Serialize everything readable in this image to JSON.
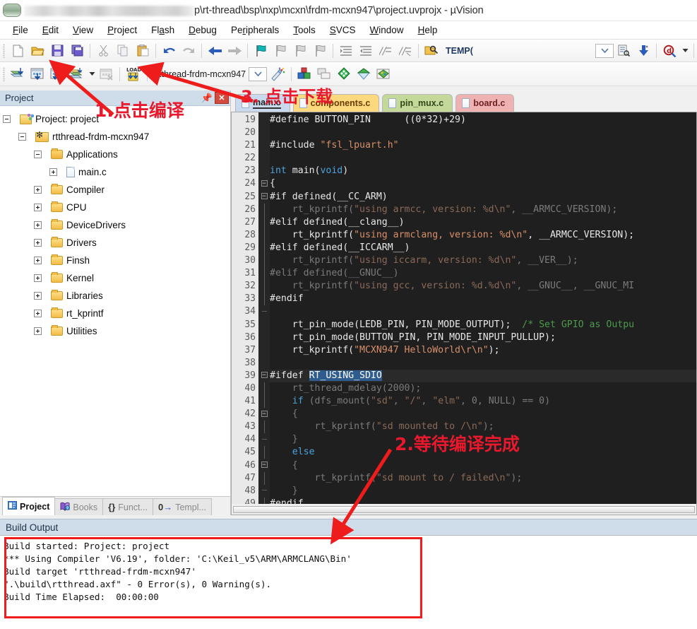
{
  "window": {
    "title_suffix": "p\\rt-thread\\bsp\\nxp\\mcxn\\frdm-mcxn947\\project.uvprojx - µVision",
    "app_icon": "uvision-icon",
    "redacted_path_note": ""
  },
  "menubar": [
    {
      "pre": "",
      "mn": "F",
      "post": "ile"
    },
    {
      "pre": "",
      "mn": "E",
      "post": "dit"
    },
    {
      "pre": "",
      "mn": "V",
      "post": "iew"
    },
    {
      "pre": "",
      "mn": "P",
      "post": "roject"
    },
    {
      "pre": "Fl",
      "mn": "a",
      "post": "sh"
    },
    {
      "pre": "",
      "mn": "D",
      "post": "ebug"
    },
    {
      "pre": "Pe",
      "mn": "r",
      "post": "ipherals"
    },
    {
      "pre": "",
      "mn": "T",
      "post": "ools"
    },
    {
      "pre": "",
      "mn": "S",
      "post": "VCS"
    },
    {
      "pre": "",
      "mn": "W",
      "post": "indow"
    },
    {
      "pre": "",
      "mn": "H",
      "post": "elp"
    }
  ],
  "toolbar_main": {
    "buttons": [
      "new-file-icon",
      "open-file-icon",
      "save-icon",
      "save-all-icon",
      "cut-icon",
      "copy-icon",
      "paste-icon",
      "undo-icon",
      "redo-icon",
      "navigate-back-icon",
      "navigate-forward-icon",
      "bookmark-toggle-icon",
      "bookmark-prev-icon",
      "bookmark-next-icon",
      "bookmark-clear-icon",
      "indent-icon",
      "outdent-icon",
      "comment-icon",
      "uncomment-icon",
      "find-in-files-icon"
    ],
    "search_label": "TEMP(",
    "dropdown_icon": "chevron-down-icon",
    "bookmark_list_icon": "bookmark-list-icon",
    "goto_icon": "goto-icon",
    "find_icon": "find-icon",
    "find_dropdown_icon": "chevron-down-icon"
  },
  "toolbar_build": {
    "buttons": [
      "translate-icon",
      "build-icon",
      "rebuild-icon",
      "batch-build-icon",
      "build-dropdown-icon",
      "stop-build-icon",
      "download-icon"
    ],
    "target_name": "rtthread-frdm-mcxn947",
    "target_dropdown_icon": "chevron-down-icon",
    "target_options_icon": "target-options-icon",
    "manage_icons": [
      "manage-project-items-icon",
      "multi-project-icon",
      "configuration-wizard-icon",
      "pack-installer-icon",
      "manage-run-time-icon"
    ]
  },
  "project_panel": {
    "caption": "Project",
    "pin_icon": "pin-icon",
    "close_icon": "close-icon",
    "tree": [
      {
        "label": "Project: project",
        "depth": 0,
        "icon": "project-icon",
        "expander": "minus"
      },
      {
        "label": "rtthread-frdm-mcxn947",
        "depth": 1,
        "icon": "target-folder-icon",
        "expander": "minus"
      },
      {
        "label": "Applications",
        "depth": 2,
        "icon": "folder-open-icon",
        "expander": "minus"
      },
      {
        "label": "main.c",
        "depth": 3,
        "icon": "c-file-icon",
        "expander": "plus"
      },
      {
        "label": "Compiler",
        "depth": 2,
        "icon": "folder-icon",
        "expander": "plus"
      },
      {
        "label": "CPU",
        "depth": 2,
        "icon": "folder-icon",
        "expander": "plus"
      },
      {
        "label": "DeviceDrivers",
        "depth": 2,
        "icon": "folder-icon",
        "expander": "plus"
      },
      {
        "label": "Drivers",
        "depth": 2,
        "icon": "folder-icon",
        "expander": "plus"
      },
      {
        "label": "Finsh",
        "depth": 2,
        "icon": "folder-icon",
        "expander": "plus"
      },
      {
        "label": "Kernel",
        "depth": 2,
        "icon": "folder-icon",
        "expander": "plus"
      },
      {
        "label": "Libraries",
        "depth": 2,
        "icon": "folder-icon",
        "expander": "plus"
      },
      {
        "label": "rt_kprintf",
        "depth": 2,
        "icon": "folder-icon",
        "expander": "plus"
      },
      {
        "label": "Utilities",
        "depth": 2,
        "icon": "folder-icon",
        "expander": "plus"
      }
    ],
    "tabs": [
      {
        "label": "Project",
        "icon": "project-tab-icon",
        "active": true
      },
      {
        "label": "Books",
        "icon": "books-icon",
        "active": false
      },
      {
        "label": "Funct...",
        "icon": "functions-icon",
        "active": false
      },
      {
        "label": "Templ...",
        "icon": "templates-icon",
        "active": false
      }
    ]
  },
  "editor": {
    "tabs": [
      {
        "label": "main.c",
        "style": "t-main",
        "active": true
      },
      {
        "label": "components.c",
        "style": "t-comp",
        "active": false
      },
      {
        "label": "pin_mux.c",
        "style": "t-pin",
        "active": false
      },
      {
        "label": "board.c",
        "style": "t-board",
        "active": false
      }
    ],
    "first_line": 19,
    "lines": [
      {
        "n": 19,
        "fold": "",
        "tokens": [
          {
            "t": "#define BUTTON_PIN      ((0*32)+29)",
            "c": "c-plain"
          }
        ]
      },
      {
        "n": 20,
        "fold": "",
        "tokens": [
          {
            "t": "",
            "c": "c-plain"
          }
        ]
      },
      {
        "n": 21,
        "fold": "",
        "tokens": [
          {
            "t": "#include ",
            "c": "c-plain"
          },
          {
            "t": "\"fsl_lpuart.h\"",
            "c": "c-str"
          }
        ]
      },
      {
        "n": 22,
        "fold": "",
        "tokens": [
          {
            "t": "",
            "c": "c-plain"
          }
        ]
      },
      {
        "n": 23,
        "fold": "",
        "tokens": [
          {
            "t": "int",
            "c": "c-kw"
          },
          {
            "t": " main(",
            "c": "c-plain"
          },
          {
            "t": "void",
            "c": "c-kw"
          },
          {
            "t": ")",
            "c": "c-plain"
          }
        ]
      },
      {
        "n": 24,
        "fold": "box",
        "tokens": [
          {
            "t": "{",
            "c": "c-plain"
          }
        ]
      },
      {
        "n": 25,
        "fold": "box",
        "tokens": [
          {
            "t": "#if defined(__CC_ARM)",
            "c": "c-plain"
          }
        ]
      },
      {
        "n": 26,
        "fold": "line",
        "tokens": [
          {
            "t": "    rt_kprintf(",
            "c": "c-dim"
          },
          {
            "t": "\"using armcc, version: %d\\n\"",
            "c": "c-str-dim"
          },
          {
            "t": ", __ARMCC_VERSION);",
            "c": "c-dim"
          }
        ]
      },
      {
        "n": 27,
        "fold": "line",
        "tokens": [
          {
            "t": "#elif defined(__clang__)",
            "c": "c-plain"
          }
        ]
      },
      {
        "n": 28,
        "fold": "line",
        "tokens": [
          {
            "t": "    rt_kprintf(",
            "c": "c-plain"
          },
          {
            "t": "\"using armclang, version: %d\\n\"",
            "c": "c-str"
          },
          {
            "t": ", __ARMCC_VERSION);",
            "c": "c-plain"
          }
        ]
      },
      {
        "n": 29,
        "fold": "line",
        "tokens": [
          {
            "t": "#elif defined(__ICCARM__)",
            "c": "c-plain"
          }
        ]
      },
      {
        "n": 30,
        "fold": "line",
        "tokens": [
          {
            "t": "    rt_kprintf(",
            "c": "c-dim"
          },
          {
            "t": "\"using iccarm, version: %d\\n\"",
            "c": "c-str-dim"
          },
          {
            "t": ", __VER__);",
            "c": "c-dim"
          }
        ]
      },
      {
        "n": 31,
        "fold": "line",
        "tokens": [
          {
            "t": "#elif defined(__GNUC__)",
            "c": "c-dim"
          }
        ]
      },
      {
        "n": 32,
        "fold": "line",
        "tokens": [
          {
            "t": "    rt_kprintf(",
            "c": "c-dim"
          },
          {
            "t": "\"using gcc, version: %d.%d\\n\"",
            "c": "c-str-dim"
          },
          {
            "t": ", __GNUC__, __GNUC_MI",
            "c": "c-dim"
          }
        ]
      },
      {
        "n": 33,
        "fold": "line",
        "tokens": [
          {
            "t": "#endif",
            "c": "c-plain"
          }
        ]
      },
      {
        "n": 34,
        "fold": "end",
        "tokens": [
          {
            "t": "",
            "c": "c-plain"
          }
        ]
      },
      {
        "n": 35,
        "fold": "",
        "tokens": [
          {
            "t": "    rt_pin_mode(LEDB_PIN, PIN_MODE_OUTPUT);  ",
            "c": "c-plain"
          },
          {
            "t": "/* Set GPIO as Outpu",
            "c": "c-cmt"
          }
        ]
      },
      {
        "n": 36,
        "fold": "",
        "tokens": [
          {
            "t": "    rt_pin_mode(BUTTON_PIN, PIN_MODE_INPUT_PULLUP);",
            "c": "c-plain"
          }
        ]
      },
      {
        "n": 37,
        "fold": "",
        "tokens": [
          {
            "t": "    rt_kprintf(",
            "c": "c-plain"
          },
          {
            "t": "\"MCXN947 HelloWorld\\r\\n\"",
            "c": "c-str"
          },
          {
            "t": ");",
            "c": "c-plain"
          }
        ]
      },
      {
        "n": 38,
        "fold": "",
        "tokens": [
          {
            "t": "",
            "c": "c-plain"
          }
        ]
      },
      {
        "n": 39,
        "fold": "box",
        "hl": true,
        "tokens": [
          {
            "t": "#ifdef ",
            "c": "c-plain"
          },
          {
            "t": "RT_USING_SDIO",
            "c": "c-sel"
          }
        ]
      },
      {
        "n": 40,
        "fold": "line",
        "tokens": [
          {
            "t": "    rt_thread_mdelay(2000);",
            "c": "c-dim"
          }
        ]
      },
      {
        "n": 41,
        "fold": "line",
        "tokens": [
          {
            "t": "    ",
            "c": "c-dim"
          },
          {
            "t": "if",
            "c": "c-kw"
          },
          {
            "t": " (dfs_mount(",
            "c": "c-dim"
          },
          {
            "t": "\"sd\"",
            "c": "c-str-dim"
          },
          {
            "t": ", ",
            "c": "c-dim"
          },
          {
            "t": "\"/\"",
            "c": "c-str-dim"
          },
          {
            "t": ", ",
            "c": "c-dim"
          },
          {
            "t": "\"elm\"",
            "c": "c-str-dim"
          },
          {
            "t": ", 0, NULL) == 0)",
            "c": "c-dim"
          }
        ]
      },
      {
        "n": 42,
        "fold": "box",
        "tokens": [
          {
            "t": "    {",
            "c": "c-dim"
          }
        ]
      },
      {
        "n": 43,
        "fold": "line",
        "tokens": [
          {
            "t": "        rt_kprintf(",
            "c": "c-dim"
          },
          {
            "t": "\"sd mounted to /\\n\"",
            "c": "c-str-dim"
          },
          {
            "t": ");",
            "c": "c-dim"
          }
        ]
      },
      {
        "n": 44,
        "fold": "end",
        "tokens": [
          {
            "t": "    }",
            "c": "c-dim"
          }
        ]
      },
      {
        "n": 45,
        "fold": "line",
        "tokens": [
          {
            "t": "    ",
            "c": "c-dim"
          },
          {
            "t": "else",
            "c": "c-kw"
          }
        ]
      },
      {
        "n": 46,
        "fold": "box",
        "tokens": [
          {
            "t": "    {",
            "c": "c-dim"
          }
        ]
      },
      {
        "n": 47,
        "fold": "line",
        "tokens": [
          {
            "t": "        rt_kprintf(",
            "c": "c-dim"
          },
          {
            "t": "\"sd mount to / failed\\n\"",
            "c": "c-str-dim"
          },
          {
            "t": ");",
            "c": "c-dim"
          }
        ]
      },
      {
        "n": 48,
        "fold": "end",
        "tokens": [
          {
            "t": "    }",
            "c": "c-dim"
          }
        ]
      },
      {
        "n": 49,
        "fold": "line",
        "tokens": [
          {
            "t": "#endif",
            "c": "c-plain"
          }
        ]
      }
    ]
  },
  "build_output": {
    "caption": "Build Output",
    "lines": [
      "Build started: Project: project",
      "*** Using Compiler 'V6.19', folder: 'C:\\Keil_v5\\ARM\\ARMCLANG\\Bin'",
      "Build target 'rtthread-frdm-mcxn947'",
      "\".\\build\\rtthread.axf\" - 0 Error(s), 0 Warning(s).",
      "Build Time Elapsed:  00:00:00"
    ]
  },
  "annotations": {
    "color": "#e8192c",
    "items": [
      {
        "id": "step-1",
        "text": "1.点击编译"
      },
      {
        "id": "step-2",
        "text": "2.等待编译完成"
      },
      {
        "id": "step-3",
        "text": "3. 点击下载"
      }
    ]
  }
}
